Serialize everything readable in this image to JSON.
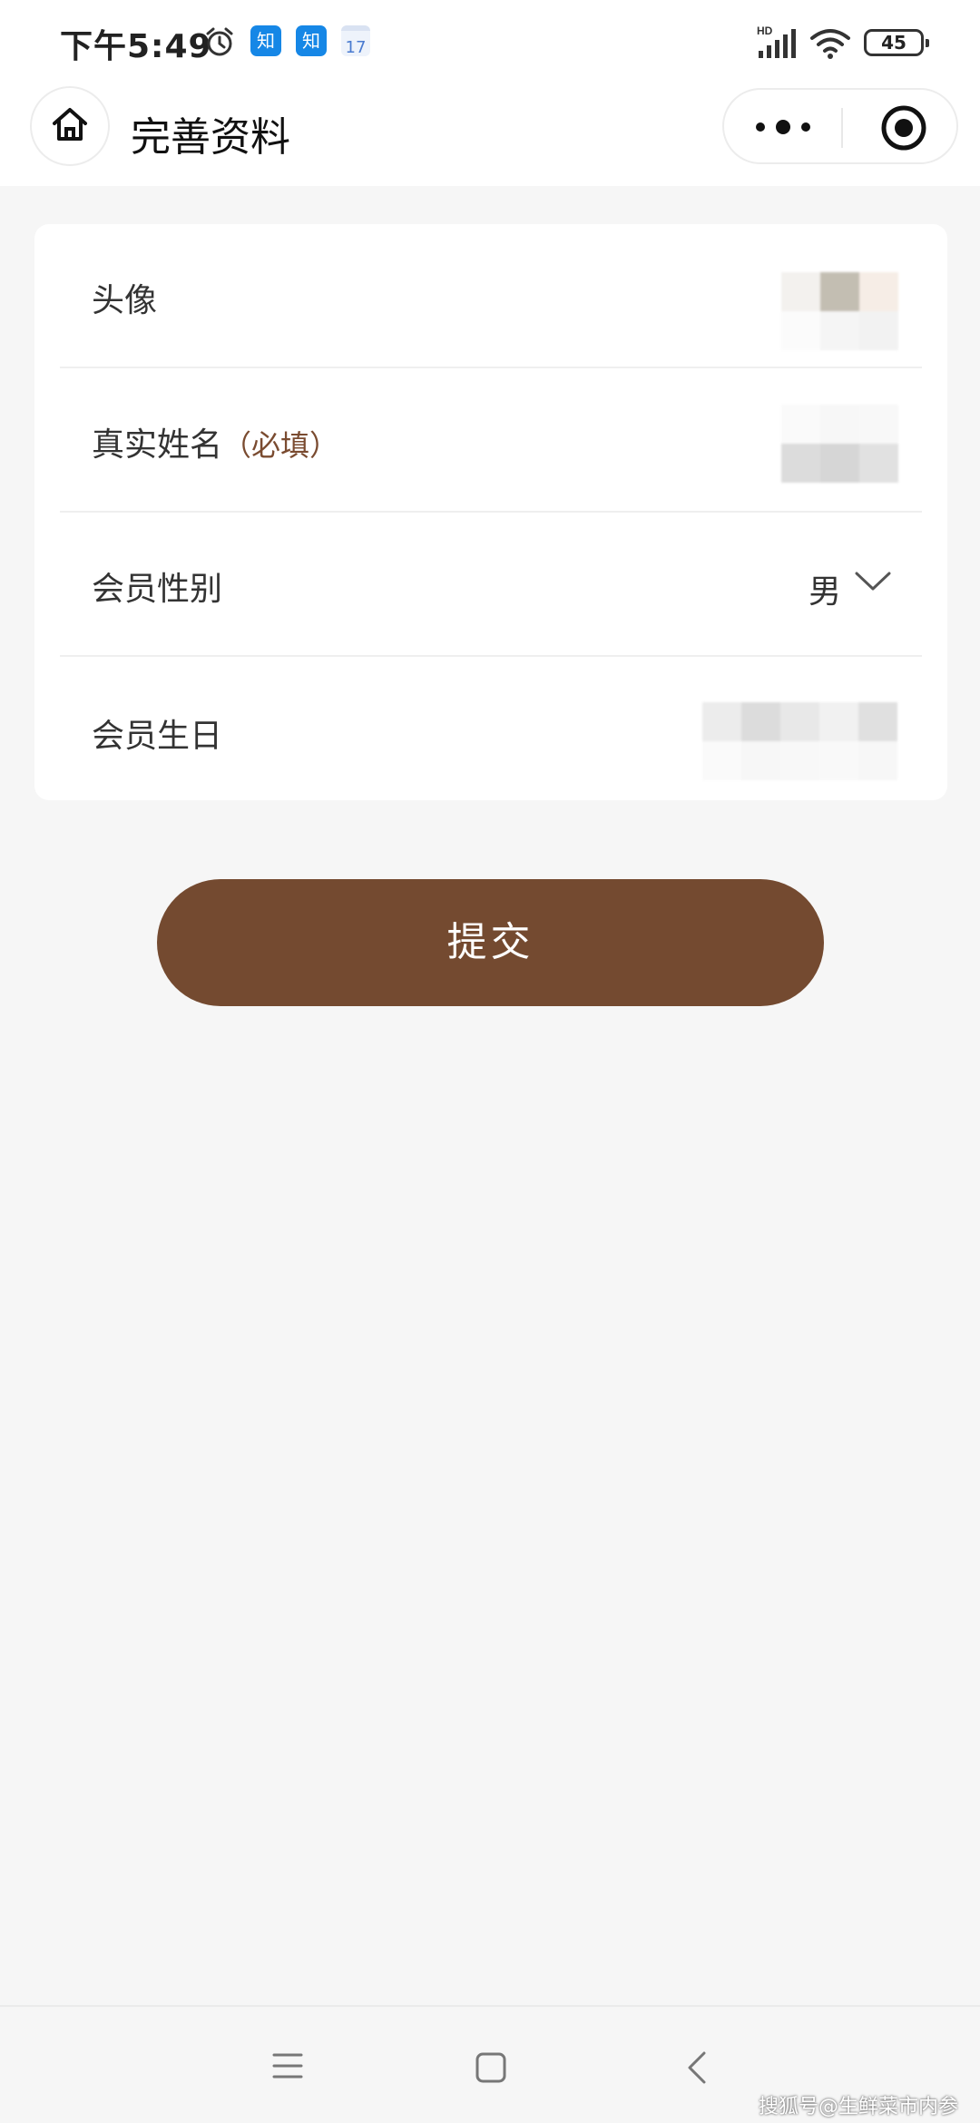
{
  "status_bar": {
    "time": "下午5:49",
    "app_badge_1": "知",
    "app_badge_2": "知",
    "calendar_day": "17",
    "network_label": "HD",
    "battery": "45"
  },
  "nav": {
    "title": "完善资料"
  },
  "form": {
    "avatar_label": "头像",
    "name_label": "真实姓名",
    "name_required": "（必填）",
    "gender_label": "会员性别",
    "gender_value": "男",
    "birthday_label": "会员生日"
  },
  "submit_label": "提交",
  "watermark": "搜狐号@生鲜菜市内参",
  "colors": {
    "accent": "#744a30",
    "background": "#f6f6f6",
    "card": "#ffffff"
  }
}
